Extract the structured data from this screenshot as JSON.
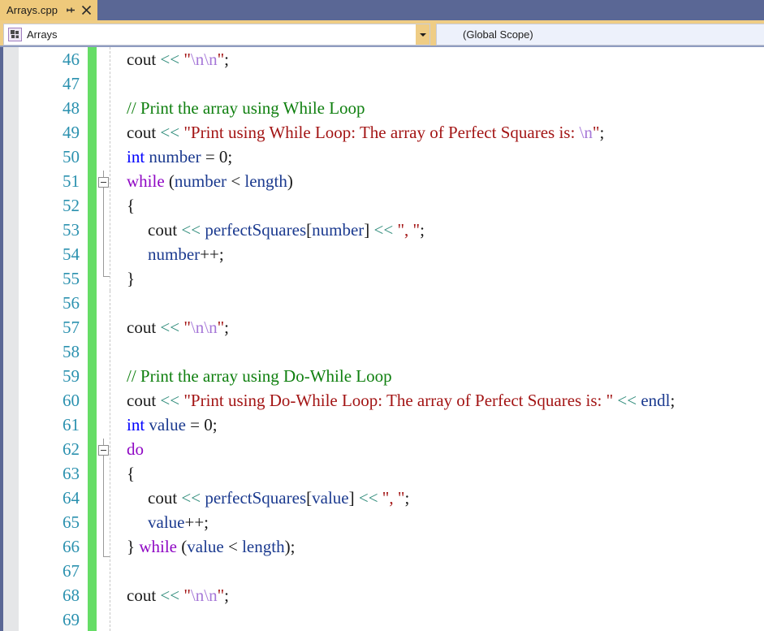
{
  "window": {
    "tab": {
      "title": "Arrays.cpp",
      "pin_icon": "pin-icon",
      "close_icon": "close-icon"
    },
    "colors": {
      "tab_background": "#eec97b",
      "tabstrip_background": "#5a6795",
      "change_bar": "#66dd66",
      "line_number": "#2b91af",
      "keyword": "#0000ff",
      "control_keyword": "#8f08c4",
      "identifier": "#1b3a8f",
      "operator": "#2e8b7a",
      "string": "#a31515",
      "escape": "#a678d8",
      "comment": "#108010"
    }
  },
  "navbar": {
    "scope_icon": "namespace-icon",
    "scope_value": "Arrays",
    "scope_dropdown_icon": "chevron-down-icon",
    "member_value": "(Global Scope)"
  },
  "editor": {
    "first_line": 46,
    "lines": [
      {
        "n": 46,
        "indent": 0,
        "tokens": [
          {
            "t": "pl",
            "v": "cout "
          },
          {
            "t": "op",
            "v": "<<"
          },
          {
            "t": "pl",
            "v": " "
          },
          {
            "t": "str",
            "v": "\""
          },
          {
            "t": "esc",
            "v": "\\n\\n"
          },
          {
            "t": "str",
            "v": "\""
          },
          {
            "t": "pl",
            "v": ";"
          }
        ]
      },
      {
        "n": 47,
        "indent": 0,
        "tokens": []
      },
      {
        "n": 48,
        "indent": 0,
        "tokens": [
          {
            "t": "cmt",
            "v": "// Print the array using While Loop"
          }
        ]
      },
      {
        "n": 49,
        "indent": 0,
        "tokens": [
          {
            "t": "pl",
            "v": "cout "
          },
          {
            "t": "op",
            "v": "<<"
          },
          {
            "t": "pl",
            "v": " "
          },
          {
            "t": "str",
            "v": "\"Print using While Loop: The array of Perfect Squares is: "
          },
          {
            "t": "esc",
            "v": "\\n"
          },
          {
            "t": "str",
            "v": "\""
          },
          {
            "t": "pl",
            "v": ";"
          }
        ]
      },
      {
        "n": 50,
        "indent": 0,
        "tokens": [
          {
            "t": "kw",
            "v": "int"
          },
          {
            "t": "pl",
            "v": " "
          },
          {
            "t": "id",
            "v": "number"
          },
          {
            "t": "pl",
            "v": " = 0;"
          }
        ]
      },
      {
        "n": 51,
        "indent": 0,
        "tokens": [
          {
            "t": "kwf",
            "v": "while"
          },
          {
            "t": "pl",
            "v": " ("
          },
          {
            "t": "id",
            "v": "number"
          },
          {
            "t": "pl",
            "v": " < "
          },
          {
            "t": "id",
            "v": "length"
          },
          {
            "t": "pl",
            "v": ")"
          }
        ]
      },
      {
        "n": 52,
        "indent": 0,
        "tokens": [
          {
            "t": "pl",
            "v": "{"
          }
        ]
      },
      {
        "n": 53,
        "indent": 1,
        "tokens": [
          {
            "t": "pl",
            "v": "cout "
          },
          {
            "t": "op",
            "v": "<<"
          },
          {
            "t": "pl",
            "v": " "
          },
          {
            "t": "id",
            "v": "perfectSquares"
          },
          {
            "t": "pl",
            "v": "["
          },
          {
            "t": "id",
            "v": "number"
          },
          {
            "t": "pl",
            "v": "] "
          },
          {
            "t": "op",
            "v": "<<"
          },
          {
            "t": "pl",
            "v": " "
          },
          {
            "t": "str",
            "v": "\", \""
          },
          {
            "t": "pl",
            "v": ";"
          }
        ]
      },
      {
        "n": 54,
        "indent": 1,
        "tokens": [
          {
            "t": "id",
            "v": "number"
          },
          {
            "t": "pl",
            "v": "++;"
          }
        ]
      },
      {
        "n": 55,
        "indent": 0,
        "tokens": [
          {
            "t": "pl",
            "v": "}"
          }
        ]
      },
      {
        "n": 56,
        "indent": 0,
        "tokens": []
      },
      {
        "n": 57,
        "indent": 0,
        "tokens": [
          {
            "t": "pl",
            "v": "cout "
          },
          {
            "t": "op",
            "v": "<<"
          },
          {
            "t": "pl",
            "v": " "
          },
          {
            "t": "str",
            "v": "\""
          },
          {
            "t": "esc",
            "v": "\\n\\n"
          },
          {
            "t": "str",
            "v": "\""
          },
          {
            "t": "pl",
            "v": ";"
          }
        ]
      },
      {
        "n": 58,
        "indent": 0,
        "tokens": []
      },
      {
        "n": 59,
        "indent": 0,
        "tokens": [
          {
            "t": "cmt",
            "v": "// Print the array using Do-While Loop"
          }
        ]
      },
      {
        "n": 60,
        "indent": 0,
        "tokens": [
          {
            "t": "pl",
            "v": "cout "
          },
          {
            "t": "op",
            "v": "<<"
          },
          {
            "t": "pl",
            "v": " "
          },
          {
            "t": "str",
            "v": "\"Print using Do-While Loop: The array of Perfect Squares is: \""
          },
          {
            "t": "pl",
            "v": " "
          },
          {
            "t": "op",
            "v": "<<"
          },
          {
            "t": "pl",
            "v": " "
          },
          {
            "t": "id",
            "v": "endl"
          },
          {
            "t": "pl",
            "v": ";"
          }
        ]
      },
      {
        "n": 61,
        "indent": 0,
        "tokens": [
          {
            "t": "kw",
            "v": "int"
          },
          {
            "t": "pl",
            "v": " "
          },
          {
            "t": "id",
            "v": "value"
          },
          {
            "t": "pl",
            "v": " = 0;"
          }
        ]
      },
      {
        "n": 62,
        "indent": 0,
        "tokens": [
          {
            "t": "kwf",
            "v": "do"
          }
        ]
      },
      {
        "n": 63,
        "indent": 0,
        "tokens": [
          {
            "t": "pl",
            "v": "{"
          }
        ]
      },
      {
        "n": 64,
        "indent": 1,
        "tokens": [
          {
            "t": "pl",
            "v": "cout "
          },
          {
            "t": "op",
            "v": "<<"
          },
          {
            "t": "pl",
            "v": " "
          },
          {
            "t": "id",
            "v": "perfectSquares"
          },
          {
            "t": "pl",
            "v": "["
          },
          {
            "t": "id",
            "v": "value"
          },
          {
            "t": "pl",
            "v": "] "
          },
          {
            "t": "op",
            "v": "<<"
          },
          {
            "t": "pl",
            "v": " "
          },
          {
            "t": "str",
            "v": "\", \""
          },
          {
            "t": "pl",
            "v": ";"
          }
        ]
      },
      {
        "n": 65,
        "indent": 1,
        "tokens": [
          {
            "t": "id",
            "v": "value"
          },
          {
            "t": "pl",
            "v": "++;"
          }
        ]
      },
      {
        "n": 66,
        "indent": 0,
        "tokens": [
          {
            "t": "pl",
            "v": "} "
          },
          {
            "t": "kwf",
            "v": "while"
          },
          {
            "t": "pl",
            "v": " ("
          },
          {
            "t": "id",
            "v": "value"
          },
          {
            "t": "pl",
            "v": " < "
          },
          {
            "t": "id",
            "v": "length"
          },
          {
            "t": "pl",
            "v": ");"
          }
        ]
      },
      {
        "n": 67,
        "indent": 0,
        "tokens": []
      },
      {
        "n": 68,
        "indent": 0,
        "tokens": [
          {
            "t": "pl",
            "v": "cout "
          },
          {
            "t": "op",
            "v": "<<"
          },
          {
            "t": "pl",
            "v": " "
          },
          {
            "t": "str",
            "v": "\""
          },
          {
            "t": "esc",
            "v": "\\n\\n"
          },
          {
            "t": "str",
            "v": "\""
          },
          {
            "t": "pl",
            "v": ";"
          }
        ]
      },
      {
        "n": 69,
        "indent": 0,
        "tokens": []
      }
    ],
    "outlining": [
      {
        "line": 51,
        "collapsed": false,
        "glyph": "minus-box"
      },
      {
        "line": 62,
        "collapsed": false,
        "glyph": "minus-box"
      }
    ]
  }
}
